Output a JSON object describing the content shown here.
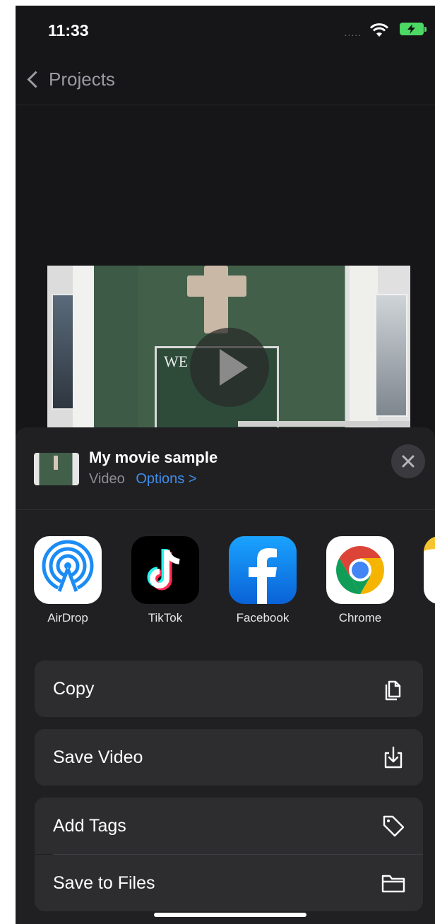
{
  "status_bar": {
    "time": "11:33"
  },
  "nav": {
    "back_label": "Projects"
  },
  "video": {
    "sign_text": "WE"
  },
  "share_sheet": {
    "title": "My movie sample",
    "type_label": "Video",
    "options_label": "Options >",
    "apps": [
      {
        "label": "AirDrop",
        "icon": "airdrop-icon"
      },
      {
        "label": "TikTok",
        "icon": "tiktok-icon"
      },
      {
        "label": "Facebook",
        "icon": "facebook-icon"
      },
      {
        "label": "Chrome",
        "icon": "chrome-icon"
      },
      {
        "label": "",
        "icon": "notes-icon"
      }
    ],
    "actions": [
      {
        "label": "Copy",
        "icon": "copy-icon"
      },
      {
        "label": "Save Video",
        "icon": "save-video-icon"
      },
      {
        "label": "Add Tags",
        "icon": "tag-icon"
      },
      {
        "label": "Save to Files",
        "icon": "folder-icon"
      }
    ]
  },
  "colors": {
    "background": "#161619",
    "sheet": "#202022",
    "row": "#2d2d30",
    "accent": "#3f8ef0",
    "battery": "#4cd964"
  }
}
